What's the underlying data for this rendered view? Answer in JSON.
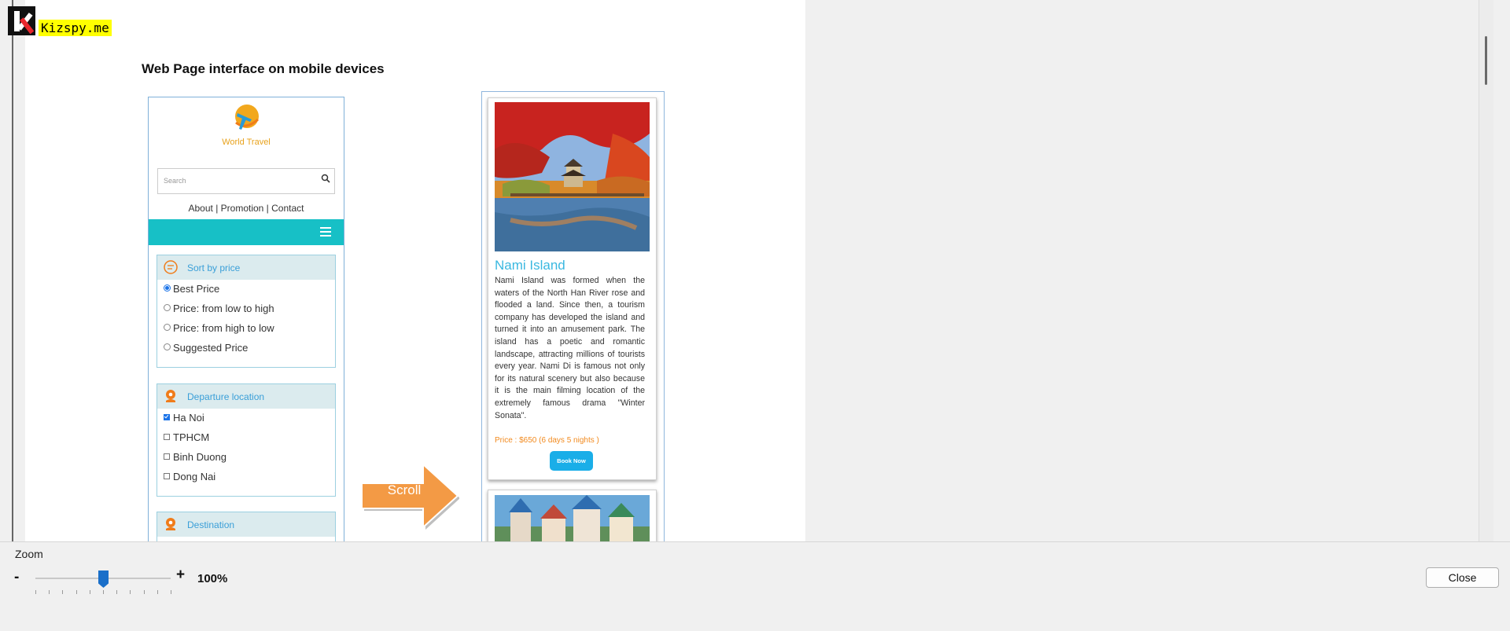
{
  "watermark": {
    "text": "Kizspy.me",
    "icon": "k-logo-icon"
  },
  "document": {
    "title": "Web Page interface on mobile devices",
    "mockup_home": {
      "brand": "World Travel",
      "search": {
        "placeholder": "Search"
      },
      "nav_links": "About | Promotion |  Contact",
      "sort": {
        "title": "Sort by price",
        "options": [
          {
            "label": "Best Price",
            "selected": true
          },
          {
            "label": "Price: from low to high",
            "selected": false
          },
          {
            "label": "Price: from high to low",
            "selected": false
          },
          {
            "label": "Suggested Price",
            "selected": false
          }
        ]
      },
      "departure": {
        "title": "Departure location",
        "options": [
          {
            "label": "Ha Noi",
            "checked": true
          },
          {
            "label": "TPHCM",
            "checked": false
          },
          {
            "label": "Binh Duong",
            "checked": false
          },
          {
            "label": "Dong Nai",
            "checked": false
          }
        ]
      },
      "destination": {
        "title": "Destination"
      }
    },
    "scroll_arrow": {
      "label": "Scroll"
    },
    "mockup_detail": {
      "card1": {
        "title": "Nami Island",
        "description": "Nami Island was formed when the waters of the North Han River rose and flooded a land. Since then, a tourism company has developed the island and turned it into an amusement park. The island has a poetic and romantic landscape, attracting millions of tourists every year. Nami Di is famous not only for its natural scenery but also because it is the main filming location of the extremely famous drama \"Winter Sonata\".",
        "price": "Price : $650 (6 days 5 nights )",
        "button": "Book Now"
      }
    }
  },
  "zoom": {
    "label": "Zoom",
    "minus": "-",
    "plus": "+",
    "value": "100%",
    "level": 0.5
  },
  "close_button": "Close",
  "colors": {
    "accent_teal": "#17c0c6",
    "link_blue": "#3ab8e0",
    "price_orange": "#f28a1e",
    "arrow_orange": "#f39a45",
    "slider_blue": "#1a6fc9"
  }
}
